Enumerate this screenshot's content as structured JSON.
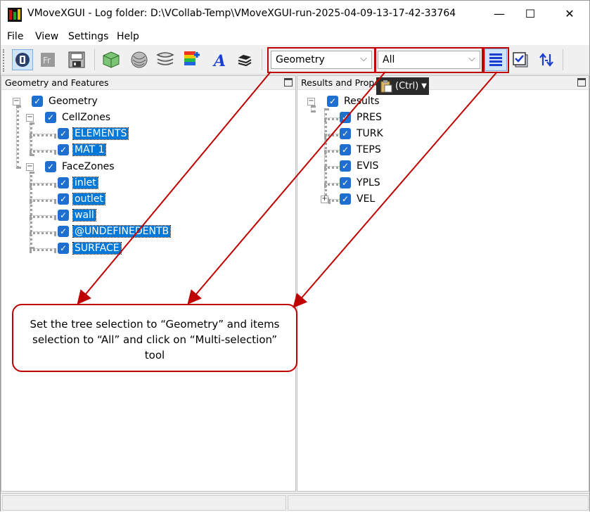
{
  "window": {
    "title": "VMoveXGUI - Log folder: D:\\VCollab-Temp\\VMoveXGUI-run-2025-04-09-13-17-42-33764",
    "minimize": "—",
    "maximize": "☐",
    "close": "✕"
  },
  "menu": [
    "File",
    "View",
    "Settings",
    "Help"
  ],
  "toolbar": {
    "tree_select": "Geometry",
    "items_select": "All",
    "icons": [
      "vcollab-logo-icon",
      "fr-icon",
      "save-icon",
      "cube-icon",
      "wrap-icon",
      "layers-icon",
      "color-layers-plus-icon",
      "text-a-icon",
      "stack-icon",
      "multi-selection-icon",
      "checkbox-icon",
      "swap-arrows-icon"
    ]
  },
  "left_panel": {
    "header": "Geometry and Features",
    "tree": {
      "root": "Geometry",
      "cellzones": {
        "label": "CellZones",
        "items": [
          "ELEMENTS",
          "MAT 1"
        ]
      },
      "facezones": {
        "label": "FaceZones",
        "items": [
          "inlet",
          "outlet",
          "wall",
          "@UNDEFINEDENTB",
          "SURFACE"
        ]
      }
    }
  },
  "right_panel": {
    "header": "Results and Prope",
    "tree": {
      "root": "Results",
      "items": [
        "PRES",
        "TURK",
        "TEPS",
        "EVIS",
        "YPLS",
        "VEL"
      ]
    }
  },
  "paste_tip": "(Ctrl)",
  "callout": "Set the tree selection to “Geometry” and items selection to “All” and click on “Multi-selection” tool",
  "colors": {
    "annotation": "#c00000",
    "selection": "#0078d7",
    "checkbox": "#1f6fd0"
  }
}
